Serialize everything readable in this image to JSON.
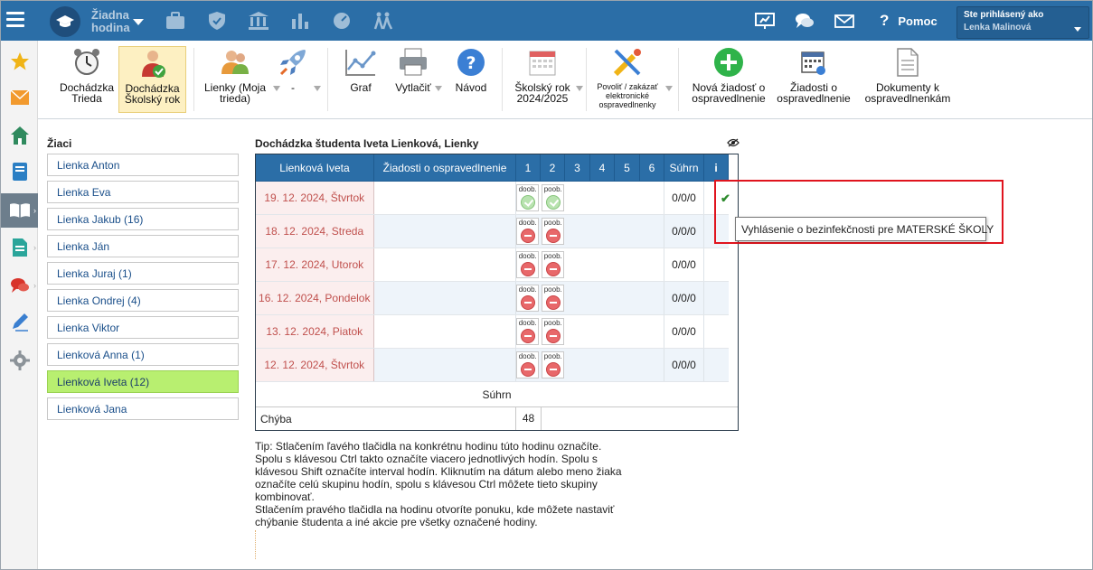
{
  "topbar": {
    "hour_label": "Žiadna hodina",
    "help_label": "Pomoc",
    "user_caption": "Ste prihlásený ako",
    "user_name": "Lenka Malinová",
    "icons": [
      "menu-icon",
      "graduation-cap-icon",
      "briefcase-icon",
      "shield-icon",
      "bank-icon",
      "bar-chart-icon",
      "dashboard-icon",
      "walking-people-icon",
      "presentation-icon",
      "chat-icon",
      "mail-icon",
      "help-icon"
    ]
  },
  "sidebar": {
    "icons": [
      "star-icon",
      "envelope-icon",
      "home-icon",
      "notebook-icon",
      "open-book-icon",
      "document-icon",
      "comments-icon",
      "pen-icon",
      "settings-icon"
    ]
  },
  "toolbar": {
    "items": [
      {
        "label": "Dochádzka Trieda"
      },
      {
        "label": "Dochádzka Školský rok"
      },
      {
        "label": "Lienky (Moja trieda)"
      },
      {
        "label": "-"
      },
      {
        "label": "Graf"
      },
      {
        "label": "Vytlačiť"
      },
      {
        "label": "Návod"
      },
      {
        "label": "Školský rok 2024/2025"
      },
      {
        "label": "Povoliť / zakázať elektronické ospravedlnenky"
      },
      {
        "label": "Nová žiadosť o ospravedlnenie"
      },
      {
        "label": "Žiadosti o ospravedlnenie"
      },
      {
        "label": "Dokumenty k ospravedlnenkám"
      }
    ]
  },
  "students": {
    "title": "Žiaci",
    "items": [
      {
        "name": "Lienka Anton"
      },
      {
        "name": "Lienka Eva"
      },
      {
        "name": "Lienka Jakub (16)"
      },
      {
        "name": "Lienka Ján"
      },
      {
        "name": "Lienka Juraj (1)"
      },
      {
        "name": "Lienka Ondrej (4)"
      },
      {
        "name": "Lienka Viktor"
      },
      {
        "name": "Lienková Anna (1)"
      },
      {
        "name": "Lienková Iveta (12)",
        "selected": true
      },
      {
        "name": "Lienková Jana"
      }
    ]
  },
  "attendance": {
    "title": "Dochádzka študenta Iveta Lienková, Lienky",
    "headers": {
      "student": "Lienková Iveta",
      "requests": "Žiadosti o ospravedlnenie",
      "hours": [
        "1",
        "2",
        "3",
        "4",
        "5",
        "6"
      ],
      "sum": "Súhrn",
      "info": "i"
    },
    "mini_labels": {
      "a": "doob.",
      "b": "poob."
    },
    "rows": [
      {
        "date": "19. 12. 2024, Štvrtok",
        "status": "present",
        "sum": "0/0/0"
      },
      {
        "date": "18. 12. 2024, Streda",
        "status": "absent",
        "sum": "0/0/0"
      },
      {
        "date": "17. 12. 2024, Utorok",
        "status": "absent",
        "sum": "0/0/0"
      },
      {
        "date": "16. 12. 2024, Pondelok",
        "status": "absent",
        "sum": "0/0/0"
      },
      {
        "date": "13. 12. 2024, Piatok",
        "status": "absent",
        "sum": "0/0/0"
      },
      {
        "date": "12. 12. 2024, Štvrtok",
        "status": "absent",
        "sum": "0/0/0"
      }
    ],
    "summary": {
      "title": "Súhrn",
      "label": "Chýba",
      "value": "48"
    }
  },
  "tooltip": {
    "text": "Vyhlásenie o bezinfekčnosti pre MATERSKÉ ŠKOLY"
  },
  "tip": {
    "paragraph1": "Tip: Stlačením ľavého tlačidla na konkrétnu hodinu túto hodinu označíte. Spolu s klávesou Ctrl takto označíte viacero jednotlivých hodín. Spolu s klávesou Shift označíte interval hodín. Kliknutím na dátum alebo meno žiaka označíte celú skupinu hodín, spolu s klávesou Ctrl môžete tieto skupiny kombinovať.",
    "paragraph2": "Stlačením pravého tlačidla na hodinu otvoríte ponuku, kde môžete nastaviť chýbanie študenta a iné akcie pre všetky označené hodiny."
  },
  "colors": {
    "brand_blue": "#2b6ea7",
    "selected_student": "#b8ef70",
    "date_red": "#c0504d",
    "highlight_red": "#e0141e"
  }
}
